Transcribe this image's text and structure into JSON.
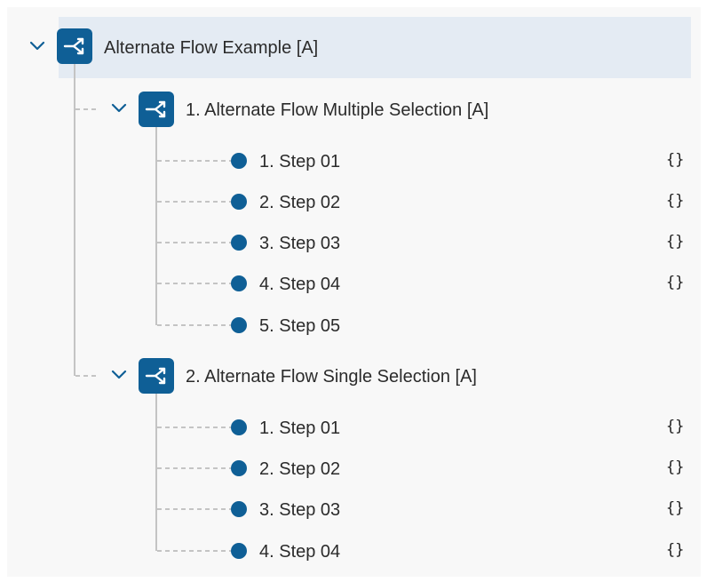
{
  "tree": {
    "root": {
      "label": "Alternate Flow Example [A]",
      "icon": "alternate-flow-icon",
      "expanded": true
    },
    "groups": [
      {
        "label": "1. Alternate Flow Multiple Selection [A]",
        "icon": "alternate-flow-icon",
        "expanded": true,
        "steps": [
          {
            "label": "1. Step 01",
            "action": "{}"
          },
          {
            "label": "2. Step 02",
            "action": "{}"
          },
          {
            "label": "3. Step 03",
            "action": "{}"
          },
          {
            "label": "4. Step 04",
            "action": "{}"
          },
          {
            "label": "5. Step 05"
          }
        ]
      },
      {
        "label": "2. Alternate Flow Single Selection [A]",
        "icon": "alternate-flow-icon",
        "expanded": true,
        "steps": [
          {
            "label": "1. Step 01",
            "action": "{}"
          },
          {
            "label": "2. Step 02",
            "action": "{}"
          },
          {
            "label": "3. Step 03",
            "action": "{}"
          },
          {
            "label": "4. Step 04",
            "action": "{}"
          }
        ]
      }
    ]
  },
  "colors": {
    "accent": "#0f5f96",
    "selected_row": "#e4ebf3",
    "panel_bg": "#f8f8f8",
    "connector": "#c4c4c4"
  }
}
